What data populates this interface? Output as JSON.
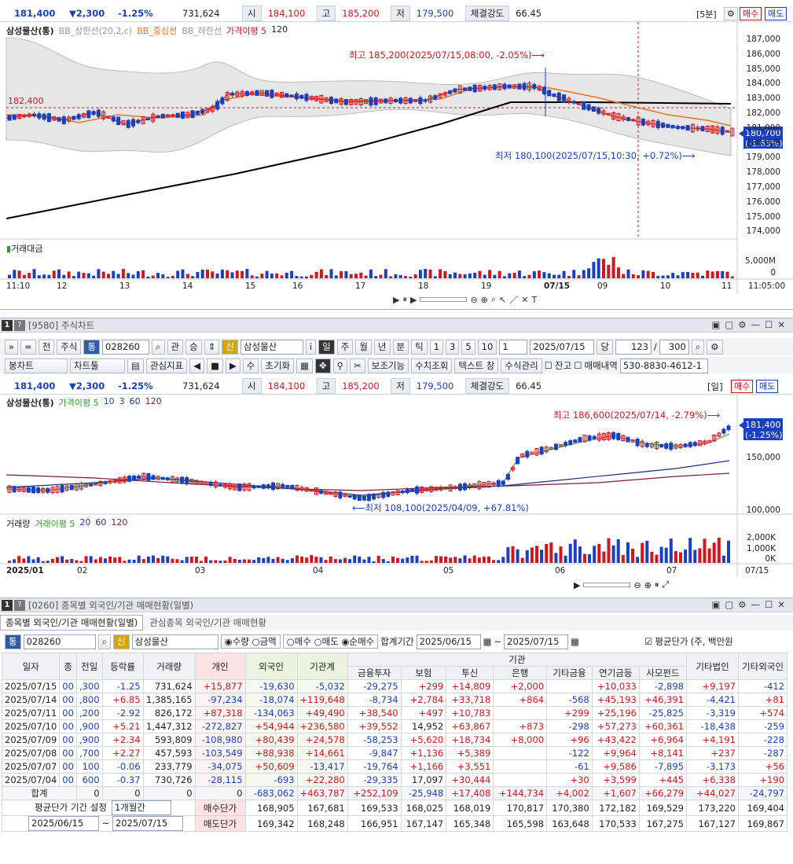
{
  "quote": {
    "price": "181,400",
    "change": "▼2,300",
    "rate": "-1.25%",
    "volume": "731,624",
    "open_label": "시",
    "open": "184,100",
    "high_label": "고",
    "high": "185,200",
    "low_label": "저",
    "low": "179,500",
    "strength_label": "체결강도",
    "strength": "66.45",
    "period": "[5분]",
    "buy": "매수",
    "sell": "매도",
    "period_day": "[일]"
  },
  "chart1": {
    "stock_name": "삼성물산(통)",
    "legend": [
      "BB_상한선(20,2,c)",
      "BB_중심선",
      "BB_하한선",
      "가격이평 5",
      "120"
    ],
    "y_ticks": [
      "187,000",
      "186,000",
      "185,000",
      "184,000",
      "183,000",
      "182,000",
      "181,000",
      "180,000",
      "179,000",
      "178,000",
      "177,000",
      "176,000",
      "175,000",
      "174,000"
    ],
    "high_note": "최고 185,200(2025/07/15,08:00, -2.05%)⟶",
    "low_note": "최저 180,100(2025/07/15,10:30, +0.72%)⟶",
    "ref_price": "182,400",
    "cur_price": "180,700",
    "cur_rate": "(-1.63%)",
    "vol_label": "거래대금",
    "vol_tick": "5,000M",
    "vol_zero": "0",
    "x_labels": [
      "11:10",
      "12",
      "13",
      "14",
      "15",
      "16",
      "17",
      "18",
      "19",
      "07/15",
      "09",
      "10",
      "11",
      "11:05:00"
    ],
    "chart_data": {
      "type": "candlestick",
      "title": "삼성물산(통) 5분",
      "high": 185200,
      "low": 180100,
      "last": 180700,
      "ylim": [
        174000,
        187000
      ],
      "ma120_start": 175000,
      "ma120_end": 182800
    }
  },
  "panel2": {
    "num": "1",
    "title": "[9580] 주식차트"
  },
  "tb2": {
    "code": "028260",
    "name": "삼성물산",
    "items": [
      "관",
      "승",
      "i",
      "일",
      "주",
      "월",
      "년",
      "분",
      "틱",
      "1",
      "3",
      "5",
      "10"
    ],
    "count1": "1",
    "date": "2025/07/15",
    "dang": "당",
    "n": "123",
    "total": "300",
    "btn_candle": "봉차트",
    "btn_tools": "차트툴",
    "btn_ind": "관심지표",
    "btn_reset": "초기화",
    "btn_aux": "보조기능",
    "btn_query": "수치조회",
    "btn_text": "텍스트 창",
    "btn_formula": "수식관리",
    "chk_balance": "잔고",
    "chk_trade": "매매내역",
    "account": "530-8830-4612-1",
    "prev": "전",
    "stock": "주식",
    "sin": "신",
    "su": "수"
  },
  "chart2": {
    "stock_name": "삼성물산(통)",
    "legend": [
      "가격이평 5",
      "10",
      "3",
      "60",
      "120"
    ],
    "y_ticks": [
      "150,000",
      "100,000"
    ],
    "high_note": "최고 186,600(2025/07/14, -2.79%)⟶",
    "low_note": "⟵최저 108,100(2025/04/09, +67.81%)",
    "cur_price": "181,400",
    "cur_rate": "(-1.25%)",
    "vol_label": "거래량",
    "vol_legend": [
      "거래이평 5",
      "20",
      "60",
      "120"
    ],
    "vol_ticks": [
      "2,000K",
      "1,000K",
      "0K"
    ],
    "x_labels": [
      "2025/01",
      "02",
      "03",
      "04",
      "05",
      "06",
      "07",
      "07/15"
    ],
    "chart_data": {
      "type": "candlestick",
      "title": "삼성물산(통) 일봉",
      "high": 186600,
      "low": 108100,
      "last": 181400,
      "ylim": [
        100000,
        190000
      ]
    }
  },
  "panel3": {
    "num": "1",
    "title": "[0260] 종목별 외국인/기관 매매현황(일별)"
  },
  "tabs": [
    "종목별 외국인/기관 매매현황(일별)",
    "관심종목 외국인/기관 매매현황"
  ],
  "filter": {
    "code": "028260",
    "name": "삼성물산",
    "opt1": "수량",
    "opt2": "금액",
    "opt3": "매수",
    "opt4": "매도",
    "opt5": "순매수",
    "period_label": "합계기간",
    "from": "2025/06/15",
    "to": "2025/07/15",
    "avg_label": "평균단가",
    "unit": "(주, 백만원"
  },
  "table": {
    "headers": [
      "일자",
      "종",
      "전일",
      "등락률",
      "거래량",
      "개인",
      "외국인",
      "기관계",
      "기관",
      "기타법인",
      "기타외국인"
    ],
    "inst_sub": [
      "금융투자",
      "보험",
      "투신",
      "은행",
      "기타금융",
      "연기금등",
      "사모펀드"
    ],
    "rows": [
      [
        "2025/07/15",
        "00",
        ",300",
        "-1.25",
        "731,624",
        "+15,877",
        "-19,630",
        "-5,032",
        "-29,275",
        "+299",
        "+14,809",
        "+2,000",
        "",
        "+10,033",
        "-2,898",
        "+9,197",
        "-412"
      ],
      [
        "2025/07/14",
        "00",
        ",800",
        "+6.85",
        "1,385,165",
        "-97,234",
        "-18,074",
        "+119,648",
        "-8,734",
        "+2,784",
        "+33,718",
        "+864",
        "-568",
        "+45,193",
        "+46,391",
        "-4,421",
        "+81"
      ],
      [
        "2025/07/11",
        "00",
        ",200",
        "-2.92",
        "826,172",
        "+87,318",
        "-134,063",
        "+49,490",
        "+38,540",
        "+497",
        "+10,783",
        "",
        "+299",
        "+25,196",
        "-25,825",
        "-3,319",
        "+574"
      ],
      [
        "2025/07/10",
        "00",
        ",900",
        "+5.21",
        "1,447,312",
        "-272,827",
        "+54,944",
        "+236,580",
        "+39,552",
        "14,952",
        "+63,867",
        "+873",
        "-298",
        "+57,273",
        "+60,361",
        "-18,438",
        "-259"
      ],
      [
        "2025/07/09",
        "00",
        ",900",
        "+2.34",
        "593,809",
        "-108,980",
        "+80,439",
        "+24,578",
        "-58,253",
        "+5,620",
        "+18,734",
        "+8,000",
        "+96",
        "+43,422",
        "+6,964",
        "+4,191",
        "-228"
      ],
      [
        "2025/07/08",
        "00",
        ",700",
        "+2.27",
        "457,593",
        "-103,549",
        "+88,938",
        "+14,661",
        "-9,847",
        "+1,136",
        "+5,389",
        "",
        "-122",
        "+9,964",
        "+8,141",
        "+237",
        "-287"
      ],
      [
        "2025/07/07",
        "00",
        "100",
        "-0.06",
        "233,779",
        "-34,075",
        "+50,609",
        "-13,417",
        "-19,764",
        "+1,166",
        "+3,551",
        "",
        "-61",
        "+9,586",
        "-7,895",
        "-3,173",
        "+56"
      ],
      [
        "2025/07/04",
        "00",
        "600",
        "-0.37",
        "730,726",
        "-28,115",
        "-693",
        "+22,280",
        "-29,335",
        "17,097",
        "+30,444",
        "",
        "+30",
        "+3,599",
        "+445",
        "+6,338",
        "+190"
      ]
    ],
    "sum_label": "합계",
    "sum": [
      "0",
      "0",
      "0",
      "0",
      "-683,062",
      "+463,787",
      "+252,109",
      "-25,948",
      "+17,408",
      "+144,734",
      "+4,002",
      "+1,607",
      "+66,279",
      "+44,027",
      "-24,797"
    ],
    "avg_period_label": "평균단가 기간 설정",
    "avg_period": "1개월간",
    "buy_avg_label": "매수단가",
    "buy_avg": [
      "168,905",
      "167,681",
      "169,533",
      "168,025",
      "168,019",
      "170,817",
      "170,380",
      "172,182",
      "169,529",
      "173,220",
      "169,404"
    ],
    "sell_avg_label": "매도단가",
    "sell_avg": [
      "169,342",
      "168,248",
      "166,951",
      "167,147",
      "165,348",
      "165,598",
      "163,648",
      "170,533",
      "167,275",
      "167,127",
      "169,867"
    ],
    "from": "2025/06/15",
    "to": "2025/07/15"
  }
}
